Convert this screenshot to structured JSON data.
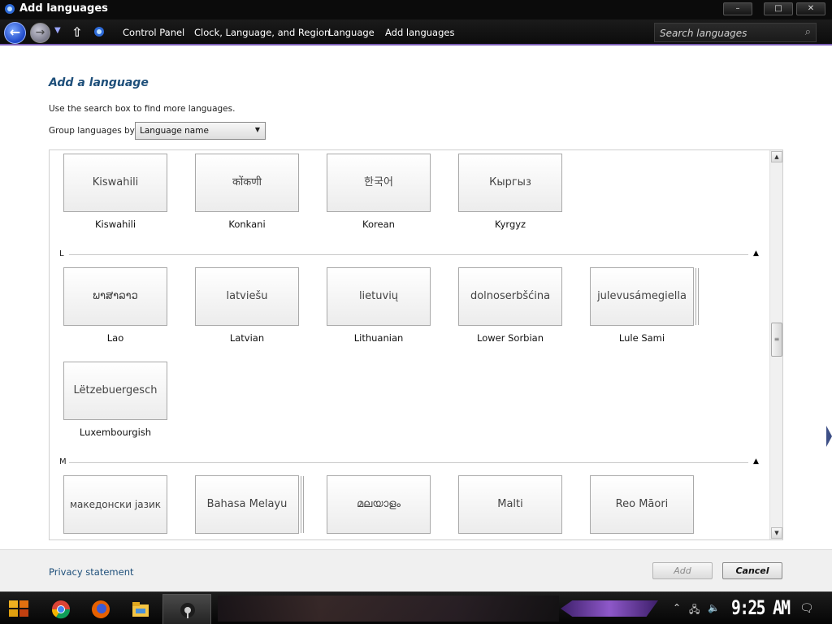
{
  "window": {
    "title": "Add languages"
  },
  "address": {
    "crumbs": [
      "Control Panel",
      "Clock, Language, and Region",
      "Language",
      "Add languages"
    ],
    "search_placeholder": "Search languages"
  },
  "heading": "Add a language",
  "hint": "Use the search box to find more languages.",
  "group": {
    "label": "Group languages by:",
    "value": "Language name"
  },
  "sections": [
    "L",
    "M"
  ],
  "tiles_k": [
    {
      "native": "Kiswahili",
      "name": "Kiswahili"
    },
    {
      "native": "कोंकणी",
      "name": "Konkani"
    },
    {
      "native": "한국어",
      "name": "Korean"
    },
    {
      "native": "Кыргыз",
      "name": "Kyrgyz"
    }
  ],
  "tiles_l": [
    {
      "native": "ພາສາລາວ",
      "name": "Lao"
    },
    {
      "native": "latviešu",
      "name": "Latvian"
    },
    {
      "native": "lietuvių",
      "name": "Lithuanian"
    },
    {
      "native": "dolnoserbšćina",
      "name": "Lower Sorbian"
    },
    {
      "native": "julevusámegiella",
      "name": "Lule Sami"
    },
    {
      "native": "Lëtzebuergesch",
      "name": "Luxembourgish"
    }
  ],
  "tiles_m": [
    {
      "native": "македонски јазик"
    },
    {
      "native": "Bahasa Melayu"
    },
    {
      "native": "മലയാളം"
    },
    {
      "native": "Malti"
    },
    {
      "native": "Reo Māori"
    }
  ],
  "footer": {
    "privacy": "Privacy statement",
    "add": "Add",
    "cancel": "Cancel"
  },
  "taskbar": {
    "clock": "9:25 AM"
  },
  "icons": {
    "back": "back-arrow-icon",
    "forward": "forward-arrow-icon",
    "up": "up-arrow-icon",
    "search": "search-icon",
    "scroll_up": "scroll-up-icon",
    "scroll_down": "scroll-down-icon"
  },
  "colors": {
    "heading": "#1e4f7a",
    "addressbar": "#0c0c0c",
    "accent": "#7b5db6"
  }
}
